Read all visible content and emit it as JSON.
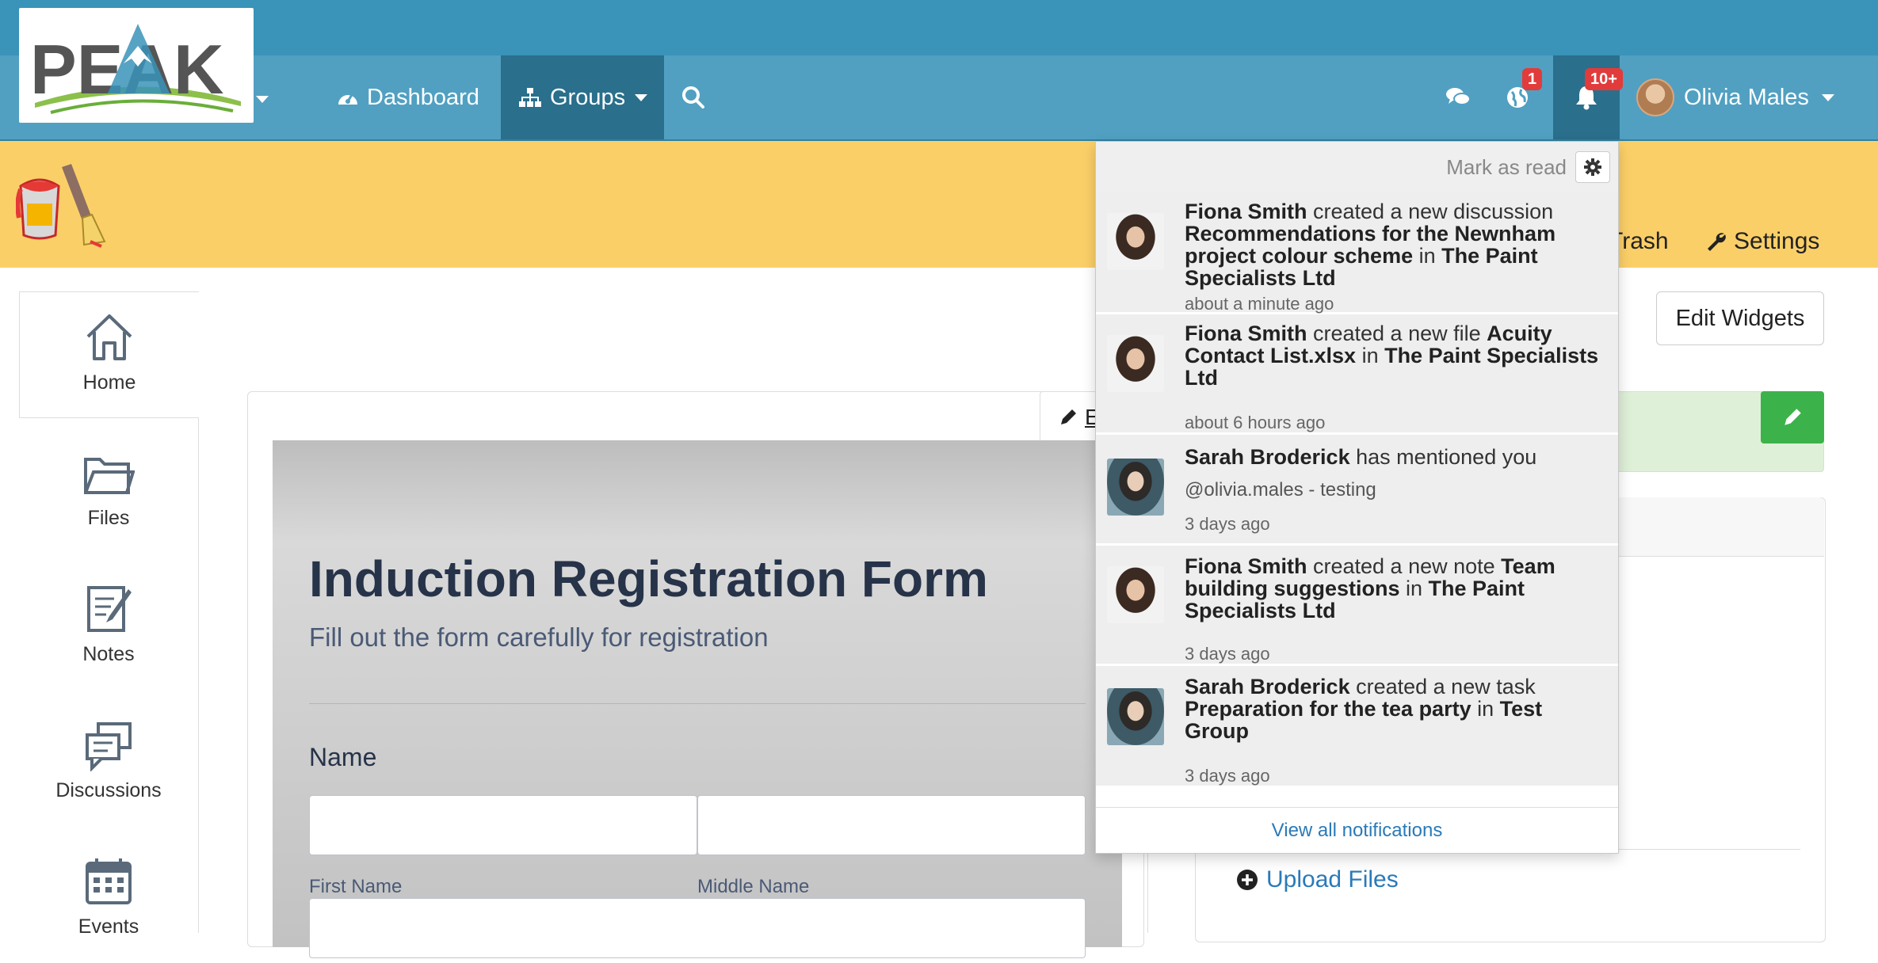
{
  "header": {
    "logo_text": "PEAK",
    "nav": [
      {
        "label": "Dashboard",
        "icon": "dashboard-icon"
      },
      {
        "label": "Groups",
        "icon": "sitemap-icon"
      }
    ],
    "search_icon": "search-icon",
    "chat_icon": "chat-icon",
    "globe_badge": "1",
    "bell_badge": "10+",
    "user_name": "Olivia Males",
    "colors": {
      "top": "#3a93b8",
      "nav": "#51a0c2",
      "active": "#2a6f8c",
      "badge": "#e23b3b"
    }
  },
  "group_bar": {
    "trash_label": "Trash",
    "settings_label": "Settings",
    "color": "#fbcf68"
  },
  "sidebar": {
    "items": [
      {
        "label": "Home",
        "icon": "home-icon"
      },
      {
        "label": "Files",
        "icon": "folder-icon"
      },
      {
        "label": "Notes",
        "icon": "notes-icon"
      },
      {
        "label": "Discussions",
        "icon": "discussions-icon"
      },
      {
        "label": "Events",
        "icon": "calendar-icon"
      }
    ]
  },
  "form": {
    "edit_label": "E",
    "title": "Induction Registration Form",
    "subtitle": "Fill out the form carefully for registration",
    "name_label": "Name",
    "first_name_label": "First Name",
    "middle_name_label": "Middle Name"
  },
  "right": {
    "edit_widgets_label": "Edit Widgets",
    "upload_label": "Upload Files"
  },
  "notifications": {
    "mark_as_read": "Mark as read",
    "view_all": "View all notifications",
    "items": [
      {
        "actor": "Fiona Smith",
        "action": " created a new discussion ",
        "subject": "Recommendations for the Newnham project colour scheme",
        "in": " in ",
        "group": "The Paint Specialists Ltd",
        "time": "about a minute ago"
      },
      {
        "actor": "Fiona Smith",
        "action": " created a new file ",
        "subject": "Acuity Contact List.xlsx",
        "in": " in ",
        "group": "The Paint Specialists Ltd",
        "time": "about 6 hours ago"
      },
      {
        "actor": "Sarah Broderick",
        "action": " has mentioned you",
        "detail": "@olivia.males - testing",
        "time": "3 days ago"
      },
      {
        "actor": "Fiona Smith",
        "action": " created a new note ",
        "subject": "Team building suggestions",
        "in": " in ",
        "group": "The Paint Specialists Ltd",
        "time": "3 days ago"
      },
      {
        "actor": "Sarah Broderick",
        "action": " created a new task ",
        "subject": "Preparation for the tea party",
        "in": " in ",
        "group": "Test Group",
        "time": "3 days ago"
      }
    ]
  }
}
